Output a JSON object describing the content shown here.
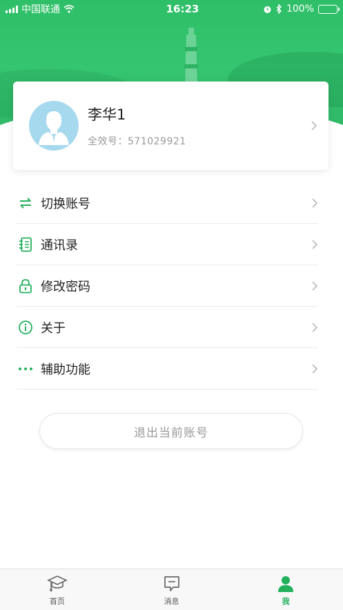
{
  "status_bar": {
    "carrier": "中国联通",
    "time": "16:23",
    "battery_percent": "100%"
  },
  "profile": {
    "name": "李华1",
    "id_label": "全效号：",
    "id_value": "571029921"
  },
  "menu": {
    "items": [
      {
        "label": "切换账号",
        "icon": "switch-arrows-icon"
      },
      {
        "label": "通讯录",
        "icon": "contacts-book-icon"
      },
      {
        "label": "修改密码",
        "icon": "lock-icon"
      },
      {
        "label": "关于",
        "icon": "info-icon"
      },
      {
        "label": "辅助功能",
        "icon": "more-dots-icon"
      }
    ]
  },
  "logout_label": "退出当前账号",
  "tabbar": {
    "tabs": [
      {
        "label": "首页",
        "icon": "graduation-cap-icon",
        "active": false
      },
      {
        "label": "消息",
        "icon": "message-icon",
        "active": false
      },
      {
        "label": "我",
        "icon": "user-icon",
        "active": true
      }
    ]
  },
  "colors": {
    "accent": "#22b05a",
    "header_green": "#35c470",
    "avatar_bg": "#a6d9ee"
  }
}
